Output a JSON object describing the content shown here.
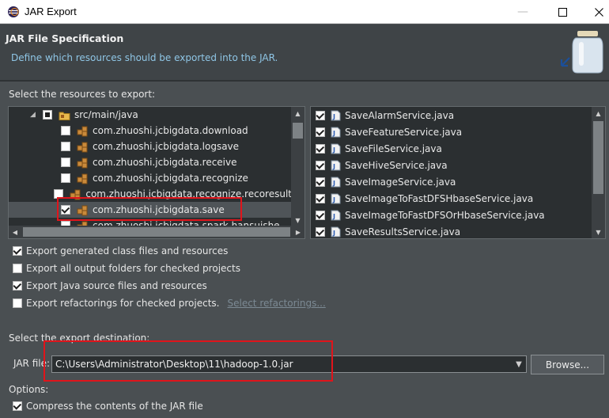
{
  "window": {
    "title": "JAR Export"
  },
  "header": {
    "title": "JAR File Specification",
    "description": "Define which resources should be exported into the JAR."
  },
  "resources": {
    "label": "Select the resources to export:",
    "tree": [
      {
        "label": "src/main/java",
        "state": "partial",
        "icon": "source-folder-icon"
      },
      {
        "label": "com.zhuoshi.jcbigdata.download",
        "checked": false,
        "icon": "package-icon"
      },
      {
        "label": "com.zhuoshi.jcbigdata.logsave",
        "checked": false,
        "icon": "package-icon"
      },
      {
        "label": "com.zhuoshi.jcbigdata.receive",
        "checked": false,
        "icon": "package-icon"
      },
      {
        "label": "com.zhuoshi.jcbigdata.recognize",
        "checked": false,
        "icon": "package-icon"
      },
      {
        "label": "com.zhuoshi.jcbigdata.recognize.recoresult",
        "checked": false,
        "icon": "package-icon"
      },
      {
        "label": "com.zhuoshi.jcbigdata.save",
        "checked": true,
        "selected": true,
        "icon": "package-icon"
      },
      {
        "label": "com.zhuoshi.jcbigdata.spark.hansuishe",
        "checked": false,
        "icon": "package-icon"
      }
    ],
    "files": [
      {
        "label": "SaveAlarmService.java",
        "checked": true
      },
      {
        "label": "SaveFeatureService.java",
        "checked": true
      },
      {
        "label": "SaveFileService.java",
        "checked": true
      },
      {
        "label": "SaveHiveService.java",
        "checked": true
      },
      {
        "label": "SaveImageService.java",
        "checked": true
      },
      {
        "label": "SaveImageToFastDFSHbaseService.java",
        "checked": true
      },
      {
        "label": "SaveImageToFastDFSOrHbaseService.java",
        "checked": true
      },
      {
        "label": "SaveResultsService.java",
        "checked": true
      }
    ]
  },
  "options_top": [
    {
      "label": "Export generated class files and resources",
      "checked": true
    },
    {
      "label": "Export all output folders for checked projects",
      "checked": false
    },
    {
      "label": "Export Java source files and resources",
      "checked": true
    },
    {
      "label": "Export refactorings for checked projects.",
      "checked": false,
      "link": "Select refactorings..."
    }
  ],
  "destination": {
    "label": "Select the export destination:",
    "jar_label": "JAR file:",
    "jar_value": "C:\\Users\\Administrator\\Desktop\\11\\hadoop-1.0.jar",
    "browse_label": "Browse..."
  },
  "options": {
    "label": "Options:",
    "compress": {
      "label": "Compress the contents of the JAR file",
      "checked": true
    }
  },
  "colors": {
    "highlight": "#e0141b",
    "description": "#8fc6e6"
  }
}
